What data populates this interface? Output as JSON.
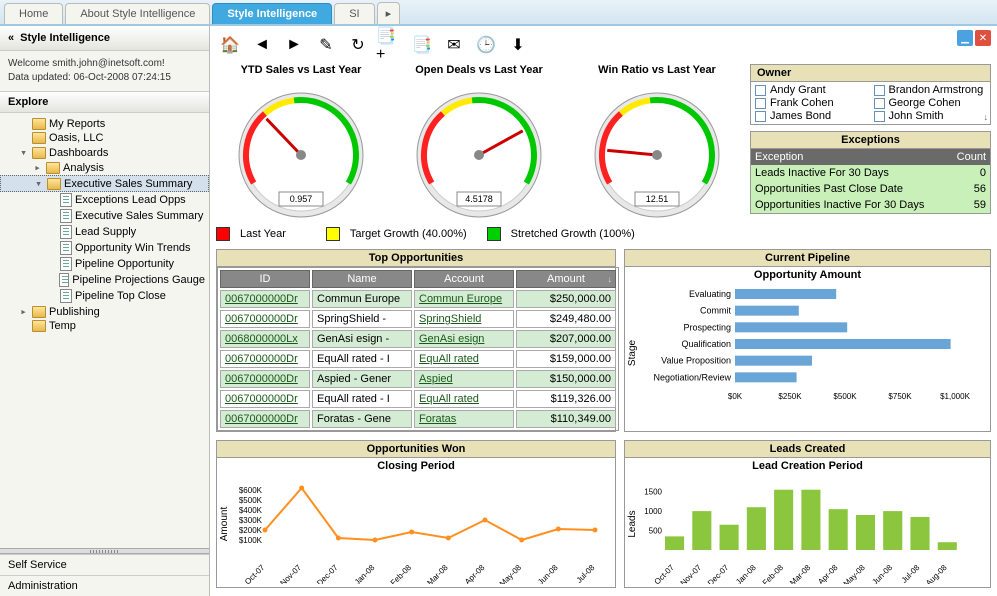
{
  "tabs": {
    "items": [
      "Home",
      "About Style Intelligence",
      "Style Intelligence",
      "SI"
    ],
    "active": 2
  },
  "sidebar": {
    "title": "Style Intelligence",
    "welcome": "Welcome smith.john@inetsoft.com!",
    "updated": "Data updated: 06-Oct-2008 07:24:15",
    "explore": "Explore",
    "tree": [
      {
        "label": "My Reports",
        "icon": "folder",
        "indent": 1
      },
      {
        "label": "Oasis, LLC",
        "icon": "folder",
        "indent": 1
      },
      {
        "label": "Dashboards",
        "icon": "folder",
        "indent": 1,
        "tw": "▾"
      },
      {
        "label": "Analysis",
        "icon": "folder",
        "indent": 2,
        "tw": "▸"
      },
      {
        "label": "Executive Sales Summary",
        "icon": "folder",
        "indent": 2,
        "tw": "▾",
        "selected": true
      },
      {
        "label": "Exceptions Lead Opps",
        "icon": "report",
        "indent": 3
      },
      {
        "label": "Executive Sales Summary",
        "icon": "report",
        "indent": 3
      },
      {
        "label": "Lead Supply",
        "icon": "report",
        "indent": 3
      },
      {
        "label": "Opportunity Win Trends",
        "icon": "report",
        "indent": 3
      },
      {
        "label": "Pipeline Opportunity",
        "icon": "report",
        "indent": 3
      },
      {
        "label": "Pipeline Projections Gauge",
        "icon": "report",
        "indent": 3
      },
      {
        "label": "Pipeline Top Close",
        "icon": "report",
        "indent": 3
      },
      {
        "label": "Publishing",
        "icon": "folder",
        "indent": 1,
        "tw": "▸"
      },
      {
        "label": "Temp",
        "icon": "folder",
        "indent": 1
      }
    ],
    "self_service": "Self Service",
    "administration": "Administration"
  },
  "toolbar_icons": [
    "home",
    "back",
    "forward",
    "edit",
    "refresh",
    "bookmark-add",
    "bookmark",
    "mail",
    "schedule",
    "export"
  ],
  "gauges": [
    {
      "title": "YTD Sales vs Last Year",
      "value": "0.957",
      "min": 0,
      "max": 3,
      "needle": 0.957
    },
    {
      "title": "Open Deals vs Last Year",
      "value": "4.5178",
      "min": 0,
      "max": 6,
      "needle": 4.5178
    },
    {
      "title": "Win Ratio vs Last Year",
      "value": "12.51",
      "min": 0,
      "max": 84,
      "needle": 12.51
    }
  ],
  "legend": {
    "last_year": {
      "label": "Last Year",
      "color": "#ff0000"
    },
    "target": {
      "label": "Target Growth (40.00%)",
      "color": "#ffff00"
    },
    "stretched": {
      "label": "Stretched Growth (100%)",
      "color": "#00d000"
    }
  },
  "owner": {
    "title": "Owner",
    "items": [
      "Andy Grant",
      "Brandon Armstrong",
      "Frank Cohen",
      "George Cohen",
      "James Bond",
      "John Smith"
    ]
  },
  "exceptions": {
    "title": "Exceptions",
    "headers": [
      "Exception",
      "Count"
    ],
    "rows": [
      {
        "label": "Leads Inactive For 30 Days",
        "count": 0
      },
      {
        "label": "Opportunities Past Close Date",
        "count": 56
      },
      {
        "label": "Opportunities Inactive For 30 Days",
        "count": 59
      }
    ]
  },
  "top_opps": {
    "title": "Top Opportunities",
    "headers": [
      "ID",
      "Name",
      "Account",
      "Amount"
    ],
    "rows": [
      {
        "id": "0067000000Dr",
        "name": "Commun Europe",
        "account": "Commun Europe",
        "amount": "$250,000.00"
      },
      {
        "id": "0067000000Dr",
        "name": "SpringShield -",
        "account": "SpringShield",
        "amount": "$249,480.00"
      },
      {
        "id": "0068000000Lx",
        "name": "GenAsi esign -",
        "account": "GenAsi esign",
        "amount": "$207,000.00"
      },
      {
        "id": "0067000000Dr",
        "name": "EquAll rated - I",
        "account": "EquAll rated",
        "amount": "$159,000.00"
      },
      {
        "id": "0067000000Dr",
        "name": "Aspied - Gener",
        "account": "Aspied",
        "amount": "$150,000.00"
      },
      {
        "id": "0067000000Dr",
        "name": "EquAll rated - I",
        "account": "EquAll rated",
        "amount": "$119,326.00"
      },
      {
        "id": "0067000000Dr",
        "name": "Foratas - Gene",
        "account": "Foratas",
        "amount": "$110,349.00"
      }
    ]
  },
  "pipeline": {
    "title": "Current Pipeline",
    "subtitle": "Opportunity Amount",
    "ylabel": "Stage"
  },
  "opps_won": {
    "title": "Opportunities Won",
    "subtitle": "Closing Period",
    "ylabel": "Amount"
  },
  "leads_created": {
    "title": "Leads Created",
    "subtitle": "Lead Creation Period",
    "ylabel": "Leads"
  },
  "chart_data": [
    {
      "type": "bar",
      "name": "Current Pipeline",
      "orientation": "horizontal",
      "xlabel": "Opportunity Amount",
      "ylabel": "Stage",
      "xlim": [
        0,
        1000000
      ],
      "xticks": [
        "$0K",
        "$250K",
        "$500K",
        "$750K",
        "$1,000K"
      ],
      "categories": [
        "Evaluating",
        "Commit",
        "Prospecting",
        "Qualification",
        "Value Proposition",
        "Negotiation/Review"
      ],
      "values": [
        460000,
        290000,
        510000,
        980000,
        350000,
        280000
      ]
    },
    {
      "type": "line",
      "name": "Opportunities Won",
      "xlabel": "Closing Period",
      "ylabel": "Amount",
      "ylim": [
        0,
        700000
      ],
      "yticks": [
        "$100K",
        "$200K",
        "$300K",
        "$400K",
        "$500K",
        "$600K"
      ],
      "categories": [
        "Oct-07",
        "Nov-07",
        "Dec-07",
        "Jan-08",
        "Feb-08",
        "Mar-08",
        "Apr-08",
        "May-08",
        "Jun-08",
        "Jul-08"
      ],
      "values": [
        200000,
        620000,
        120000,
        100000,
        180000,
        120000,
        300000,
        100000,
        210000,
        200000
      ]
    },
    {
      "type": "bar",
      "name": "Leads Created",
      "xlabel": "Lead Creation Period",
      "ylabel": "Leads",
      "ylim": [
        0,
        1800
      ],
      "yticks": [
        500,
        1000,
        1500
      ],
      "categories": [
        "Oct-07",
        "Nov-07",
        "Dec-07",
        "Jan-08",
        "Feb-08",
        "Mar-08",
        "Apr-08",
        "May-08",
        "Jun-08",
        "Jul-08",
        "Aug-08"
      ],
      "values": [
        350,
        1000,
        650,
        1100,
        1550,
        1550,
        1050,
        900,
        1000,
        850,
        200
      ]
    }
  ]
}
